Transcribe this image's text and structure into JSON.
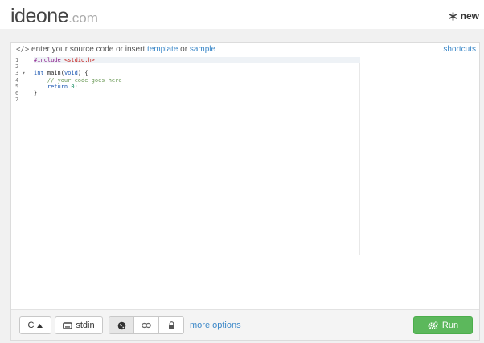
{
  "header": {
    "logo_main": "ideone",
    "logo_domain": ".com",
    "new_label": "new"
  },
  "editor_bar": {
    "glyph": "</>",
    "lead_text": " enter your source code or insert ",
    "template_link": "template",
    "or_text": " or ",
    "sample_link": "sample",
    "shortcuts_link": "shortcuts"
  },
  "editor": {
    "line_numbers": [
      "1",
      "2",
      "3",
      "4",
      "5",
      "6",
      "7"
    ],
    "fold_marker_line": 3,
    "lines": [
      "#include <stdio.h>",
      "",
      "int main(void) {",
      "    // your code goes here",
      "    return 0;",
      "}",
      ""
    ]
  },
  "toolbar": {
    "language": "C",
    "stdin_label": "stdin",
    "more_options": "more options",
    "run_label": "Run"
  },
  "icons": {
    "new": "asterisk-icon",
    "stdin": "keyboard-icon",
    "public": "globe-icon",
    "link": "link-icon",
    "private": "lock-icon",
    "run": "gears-icon"
  },
  "colors": {
    "link": "#3a87c8",
    "run_button": "#5cb85c",
    "band": "#f1f1f1"
  }
}
